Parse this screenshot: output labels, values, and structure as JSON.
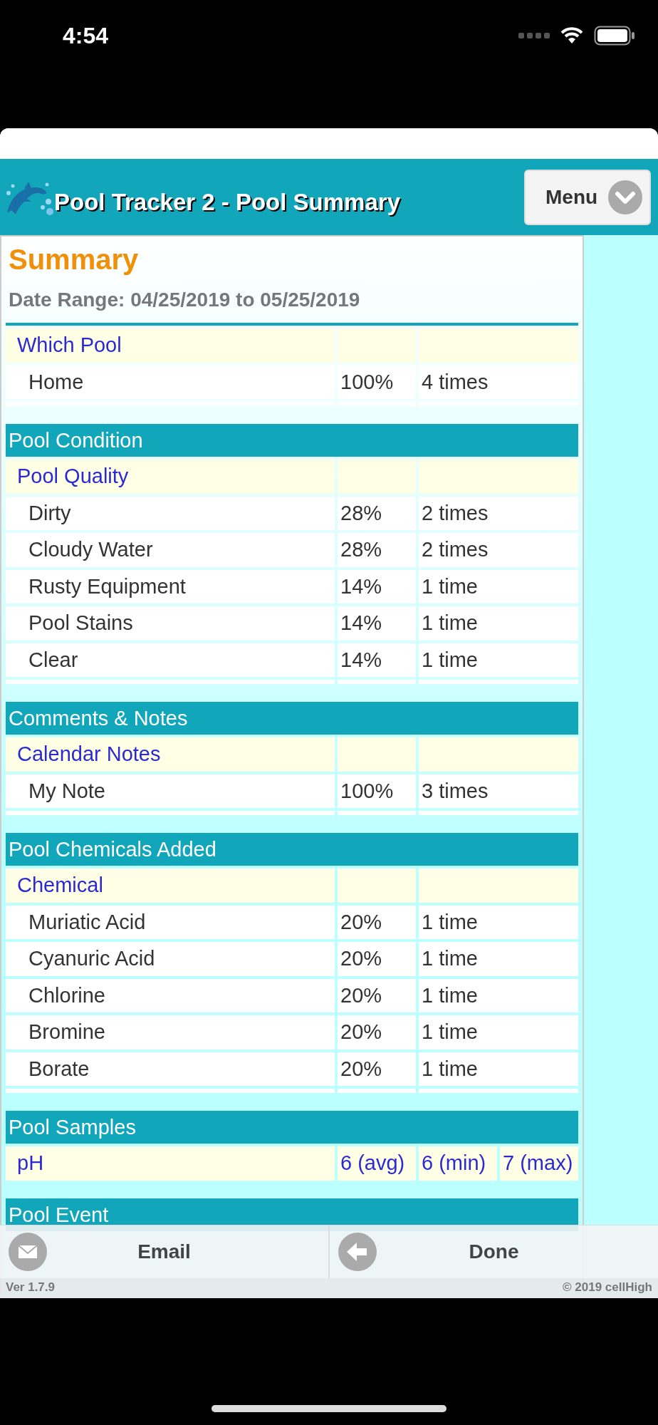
{
  "status_bar": {
    "time": "4:54"
  },
  "header": {
    "title": "Pool Tracker 2 - Pool Summary",
    "menu_button": "Menu"
  },
  "summary": {
    "title": "Summary",
    "date_range": "Date Range: 04/25/2019 to 05/25/2019"
  },
  "sections": [
    {
      "groups": [
        {
          "label": "Which Pool",
          "rows": [
            {
              "cells": [
                "Home",
                "100%",
                "4 times"
              ]
            }
          ]
        }
      ]
    },
    {
      "heading": "Pool Condition",
      "groups": [
        {
          "label": "Pool Quality",
          "rows": [
            {
              "cells": [
                "Dirty",
                "28%",
                "2 times"
              ]
            },
            {
              "cells": [
                "Cloudy Water",
                "28%",
                "2 times"
              ]
            },
            {
              "cells": [
                "Rusty Equipment",
                "14%",
                "1 time"
              ]
            },
            {
              "cells": [
                "Pool Stains",
                "14%",
                "1 time"
              ]
            },
            {
              "cells": [
                "Clear",
                "14%",
                "1 time"
              ]
            }
          ]
        }
      ]
    },
    {
      "heading": "Comments & Notes",
      "groups": [
        {
          "label": "Calendar Notes",
          "rows": [
            {
              "cells": [
                "My Note",
                "100%",
                "3 times"
              ]
            }
          ]
        }
      ]
    },
    {
      "heading": "Pool Chemicals Added",
      "groups": [
        {
          "label": "Chemical",
          "rows": [
            {
              "cells": [
                "Muriatic Acid",
                "20%",
                "1 time"
              ]
            },
            {
              "cells": [
                "Cyanuric Acid",
                "20%",
                "1 time"
              ]
            },
            {
              "cells": [
                "Chlorine",
                "20%",
                "1 time"
              ]
            },
            {
              "cells": [
                "Bromine",
                "20%",
                "1 time"
              ]
            },
            {
              "cells": [
                "Borate",
                "20%",
                "1 time"
              ]
            }
          ]
        }
      ]
    },
    {
      "heading": "Pool Samples",
      "groups": [
        {
          "label": "pH",
          "values": [
            "6 (avg)",
            "6 (min)",
            "7 (max)"
          ]
        }
      ]
    },
    {
      "heading": "Pool Event"
    }
  ],
  "toolbar": {
    "buttons": [
      {
        "kind": "email",
        "label": "Email"
      },
      {
        "kind": "back",
        "label": "Done"
      }
    ],
    "version": "Ver 1.7.9",
    "copyright": "© 2019 cellHigh"
  }
}
